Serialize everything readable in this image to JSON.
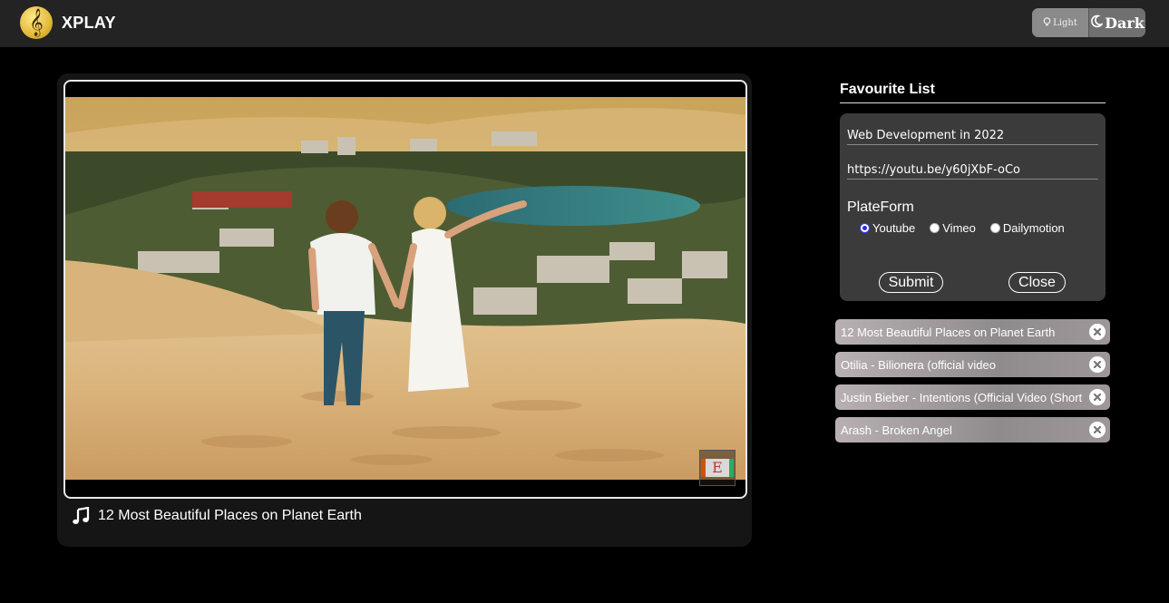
{
  "app": {
    "name": "XPLAY",
    "logo_icon": "treble-clef-icon"
  },
  "theme_toggle": {
    "light_label": "Light",
    "dark_label": "Dark",
    "light_icon": "lightbulb-icon",
    "dark_icon": "moon-icon"
  },
  "player": {
    "now_playing_title": "12 Most Beautiful Places on Planet Earth",
    "music_icon": "music-note-icon"
  },
  "favourites": {
    "title": "Favourite List",
    "form": {
      "name_value": "Web Development in 2022",
      "url_value": "https://youtu.be/y60jXbF-oCo",
      "platform_label": "PlateForm",
      "platforms": [
        "Youtube",
        "Vimeo",
        "Dailymotion"
      ],
      "selected_platform": "Youtube",
      "submit_label": "Submit",
      "close_label": "Close"
    },
    "items": [
      {
        "label": "12 Most Beautiful Places on Planet Earth"
      },
      {
        "label": "Otilia - Bilionera (official video"
      },
      {
        "label": "Justin Bieber - Intentions (Official Video (Short"
      },
      {
        "label": "Arash - Broken Angel"
      }
    ]
  },
  "colors": {
    "background": "#000000",
    "topbar": "#232323",
    "card": "#151515",
    "form": "#3b3b3b"
  }
}
